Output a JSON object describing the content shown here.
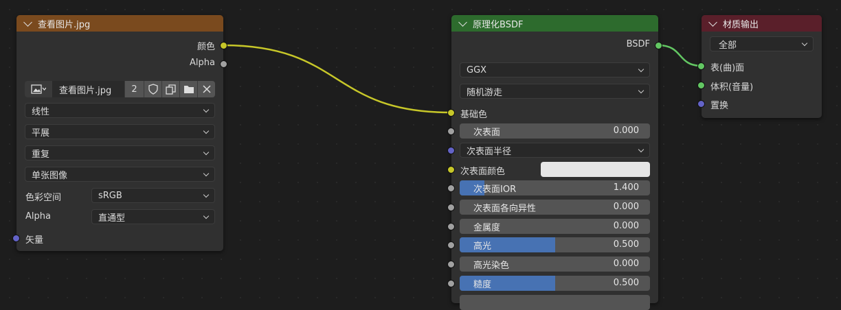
{
  "image_node": {
    "title": "查看图片.jpg",
    "header_color": "#7a4a1e",
    "outputs": {
      "color": "颜色",
      "alpha": "Alpha"
    },
    "image_selector": {
      "name": "查看图片.jpg",
      "users": "2"
    },
    "interpolation": "线性",
    "projection": "平展",
    "extension": "重复",
    "source": "单张图像",
    "color_space": {
      "label": "色彩空间",
      "value": "sRGB"
    },
    "alpha": {
      "label": "Alpha",
      "value": "直通型"
    },
    "input_vector": "矢量"
  },
  "bsdf_node": {
    "title": "原理化BSDF",
    "header_color": "#2d6b2d",
    "output": "BSDF",
    "distribution": "GGX",
    "subsurface_method": "随机游走",
    "base_color": "基础色",
    "fields": [
      {
        "label": "次表面",
        "value": "0.000",
        "fill": 0.0
      },
      {
        "label": "次表面IOR",
        "value": "1.400",
        "fill": 0.13
      },
      {
        "label": "次表面各向异性",
        "value": "0.000",
        "fill": 0.0
      },
      {
        "label": "金属度",
        "value": "0.000",
        "fill": 0.0
      },
      {
        "label": "高光",
        "value": "0.500",
        "fill": 0.5
      },
      {
        "label": "高光染色",
        "value": "0.000",
        "fill": 0.0
      },
      {
        "label": "糙度",
        "value": "0.500",
        "fill": 0.5
      }
    ],
    "subsurface_radius": "次表面半径",
    "subsurface_color": {
      "label": "次表面颜色",
      "swatch": "#e6e6e6"
    }
  },
  "output_node": {
    "title": "材质输出",
    "header_color": "#5a1f2a",
    "target": "全部",
    "inputs": {
      "surface": "表(曲)面",
      "volume": "体积(音量)",
      "displacement": "置换"
    }
  },
  "link_colors": {
    "color_link": "#c7c729",
    "shader_link": "#63c763"
  }
}
